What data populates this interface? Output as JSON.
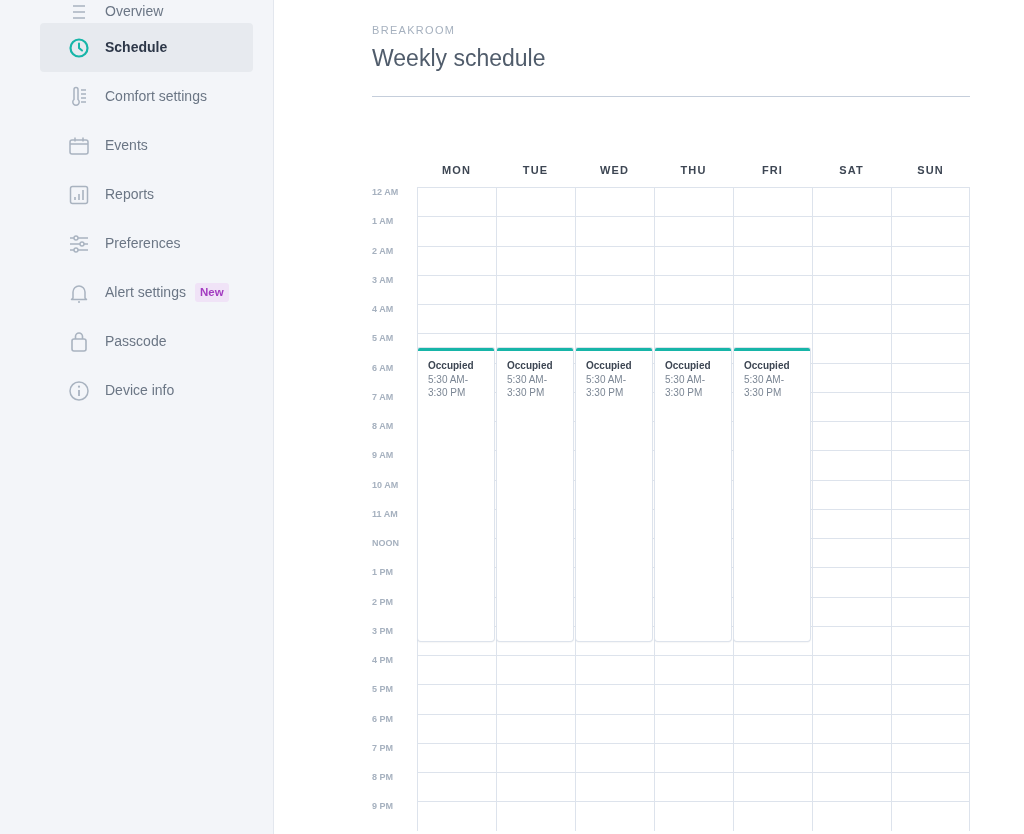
{
  "sidebar": {
    "items": [
      {
        "label": "Overview",
        "kind": "lines",
        "selected": false
      },
      {
        "label": "Schedule",
        "kind": "clock",
        "selected": true
      },
      {
        "label": "Comfort settings",
        "kind": "thermometer",
        "selected": false
      },
      {
        "label": "Events",
        "kind": "calendar",
        "selected": false
      },
      {
        "label": "Reports",
        "kind": "chart",
        "selected": false
      },
      {
        "label": "Preferences",
        "kind": "sliders",
        "selected": false
      },
      {
        "label": "Alert settings",
        "kind": "bell",
        "selected": false,
        "badge": "New"
      },
      {
        "label": "Passcode",
        "kind": "lock",
        "selected": false
      },
      {
        "label": "Device info",
        "kind": "info",
        "selected": false
      }
    ]
  },
  "page": {
    "eyebrow": "BREAKROOM",
    "title": "Weekly schedule"
  },
  "schedule": {
    "hours": [
      "12 AM",
      "1 AM",
      "2 AM",
      "3 AM",
      "4 AM",
      "5 AM",
      "6 AM",
      "7 AM",
      "8 AM",
      "9 AM",
      "10 AM",
      "11 AM",
      "NOON",
      "1 PM",
      "2 PM",
      "3 PM",
      "4 PM",
      "5 PM",
      "6 PM",
      "7 PM",
      "8 PM",
      "9 PM"
    ],
    "days": [
      {
        "label": "MON",
        "events": [
          {
            "label": "Occupied",
            "time": "5:30 AM-3:30 PM"
          }
        ]
      },
      {
        "label": "TUE",
        "events": [
          {
            "label": "Occupied",
            "time": "5:30 AM-3:30 PM"
          }
        ]
      },
      {
        "label": "WED",
        "events": [
          {
            "label": "Occupied",
            "time": "5:30 AM-3:30 PM"
          }
        ]
      },
      {
        "label": "THU",
        "events": [
          {
            "label": "Occupied",
            "time": "5:30 AM-3:30 PM"
          }
        ]
      },
      {
        "label": "FRI",
        "events": [
          {
            "label": "Occupied",
            "time": "5:30 AM-3:30 PM"
          }
        ]
      },
      {
        "label": "SAT"
      },
      {
        "label": "SUN"
      }
    ]
  }
}
